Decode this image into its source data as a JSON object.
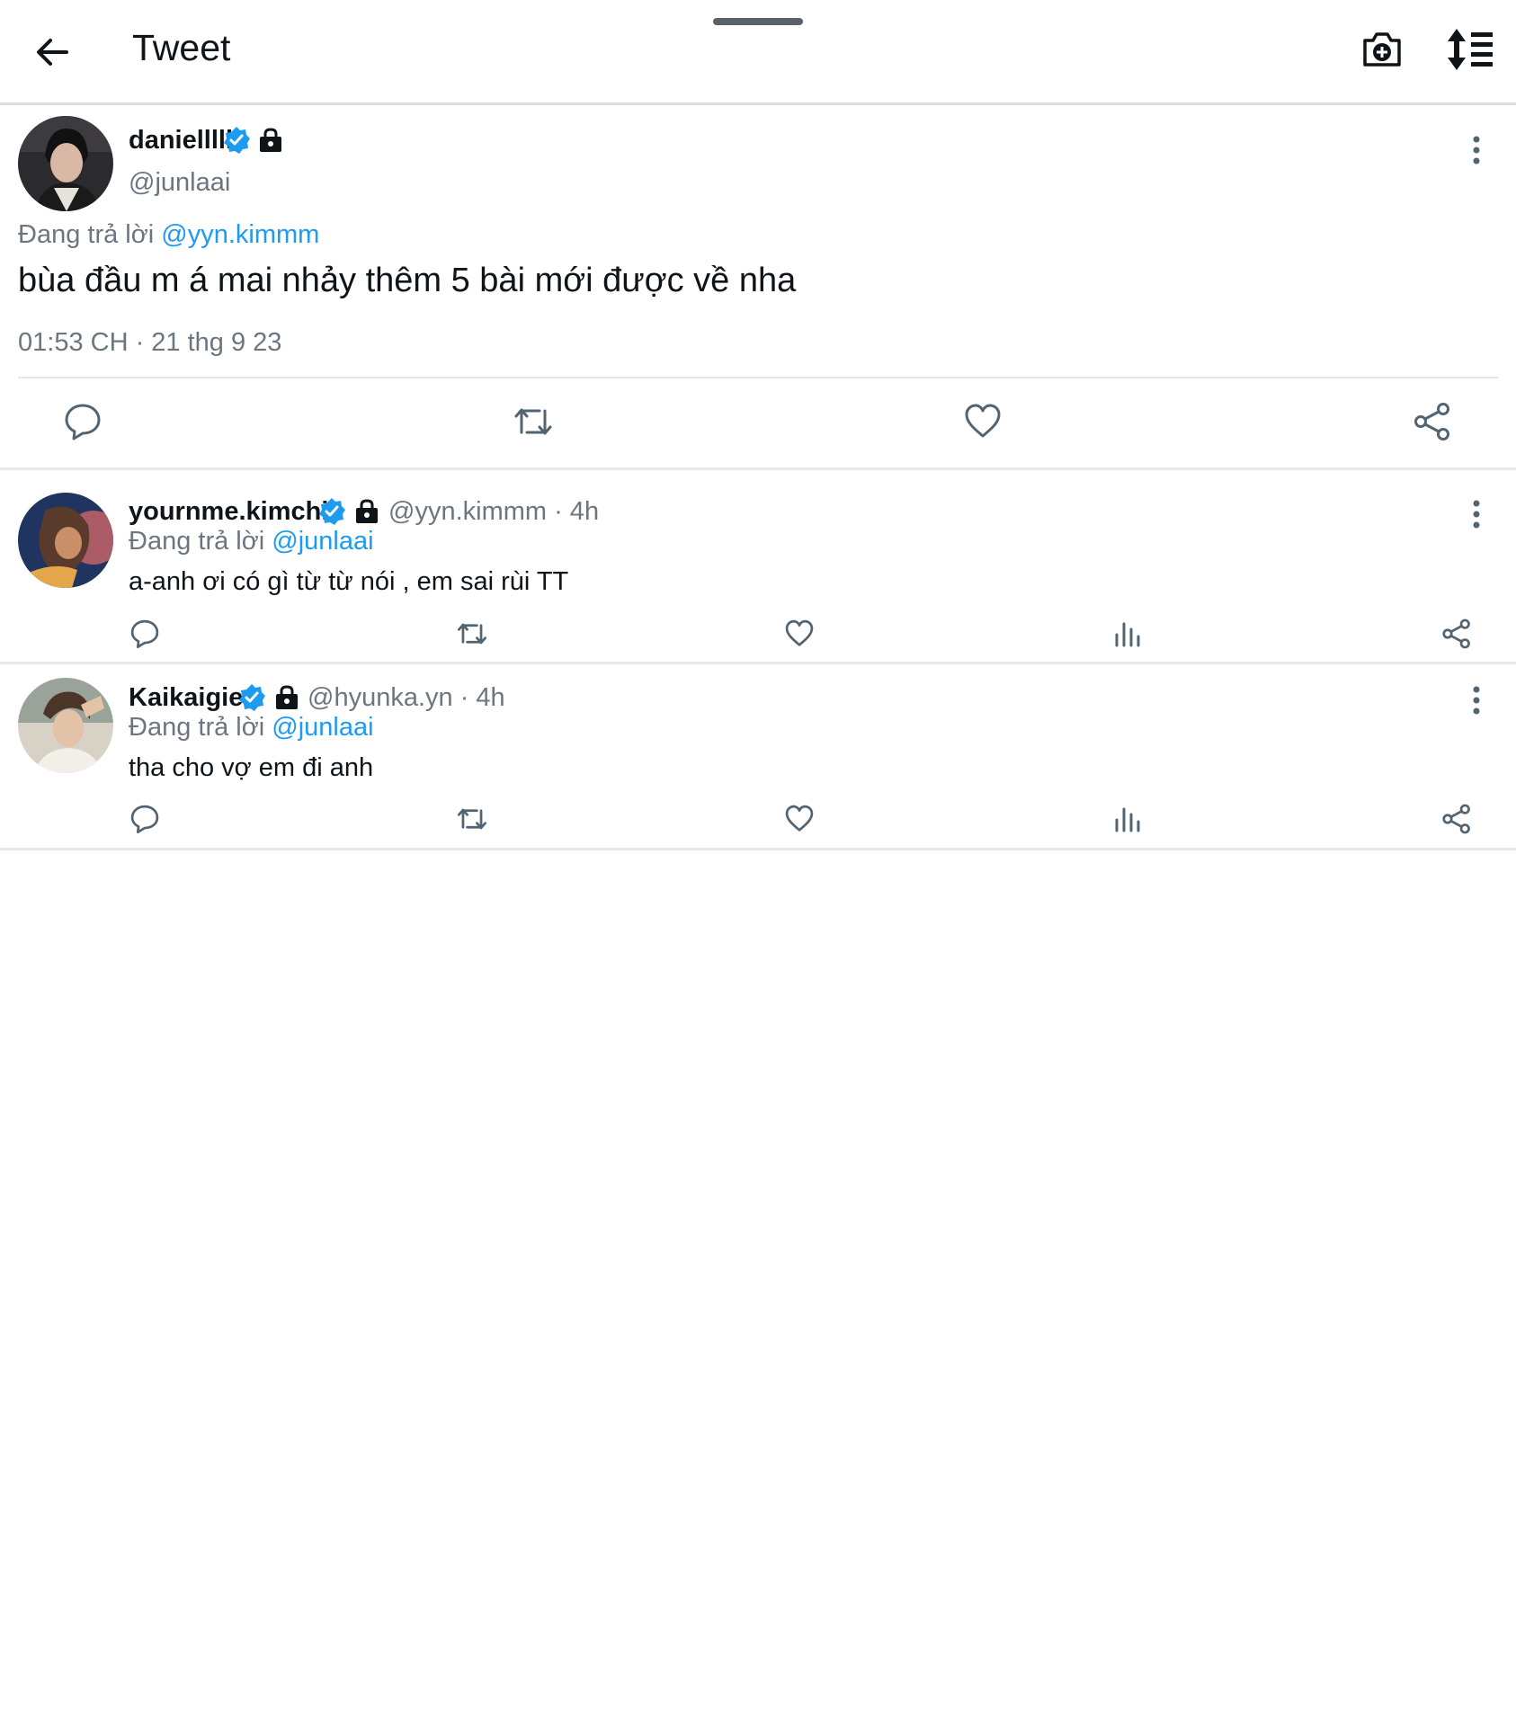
{
  "header": {
    "title": "Tweet",
    "back_icon": "arrow-left-icon",
    "camera_icon": "camera-plus-icon",
    "sort_icon": "sort-list-icon"
  },
  "main_tweet": {
    "display_name": "danielllll",
    "username": "@junlaai",
    "replying_prefix": "Đang trả lời",
    "replying_to": "@yyn.kimmm",
    "text": "bùa đầu m á mai nhảy thêm 5 bài mới được về nha",
    "timestamp": "01:53 CH · 21 thg 9 23"
  },
  "replies": [
    {
      "display_name": "yournme.kimchi",
      "meta": "@yyn.kimmm · 4h",
      "replying_prefix": "Đang trả lời",
      "replying_to": "@junlaai",
      "text": "a-anh ơi có gì từ từ nói , em sai rùi TT"
    },
    {
      "display_name": "Kaikaigie",
      "meta": "@hyunka.yn · 4h",
      "replying_prefix": "Đang trả lời",
      "replying_to": "@junlaai",
      "text": "tha cho vợ em đi anh"
    }
  ],
  "colors": {
    "accent": "#1d9bf0",
    "text": "#0f1419",
    "secondary": "#6b7680",
    "divider": "#e4e7e9"
  }
}
